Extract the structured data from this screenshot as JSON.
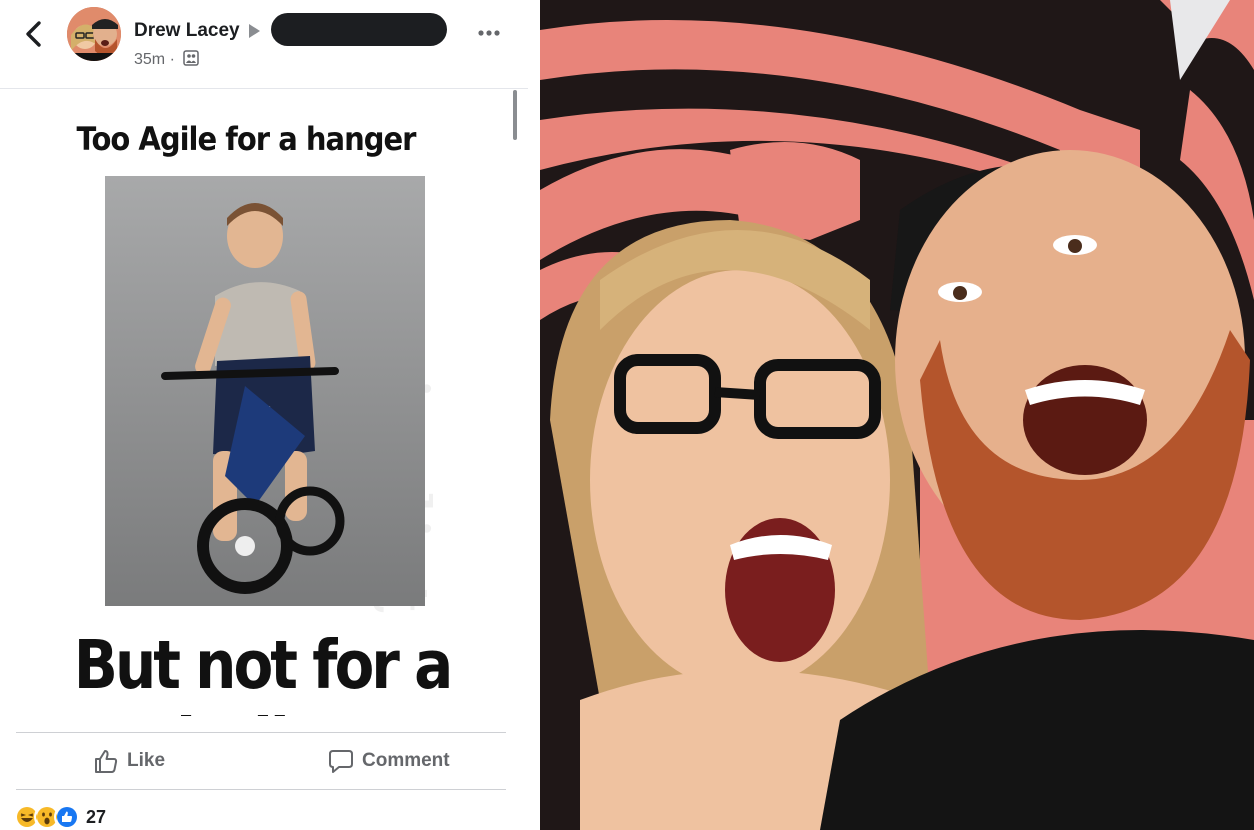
{
  "post": {
    "author": "Drew Lacey",
    "time": "35m",
    "separator": "·",
    "audience_icon": "group-audience-icon"
  },
  "meme": {
    "top_text": "Too Agile for a hanger",
    "bottom_text": "But not for a bullet",
    "watermark": "craigslist"
  },
  "actions": {
    "like_label": "Like",
    "comment_label": "Comment"
  },
  "reactions": {
    "types": [
      "haha",
      "wow",
      "like"
    ],
    "count": "27"
  },
  "colors": {
    "secondary_text": "#65676b",
    "primary_text": "#1c1e21",
    "like_blue": "#1877f2",
    "reaction_yellow": "#f7b928"
  }
}
